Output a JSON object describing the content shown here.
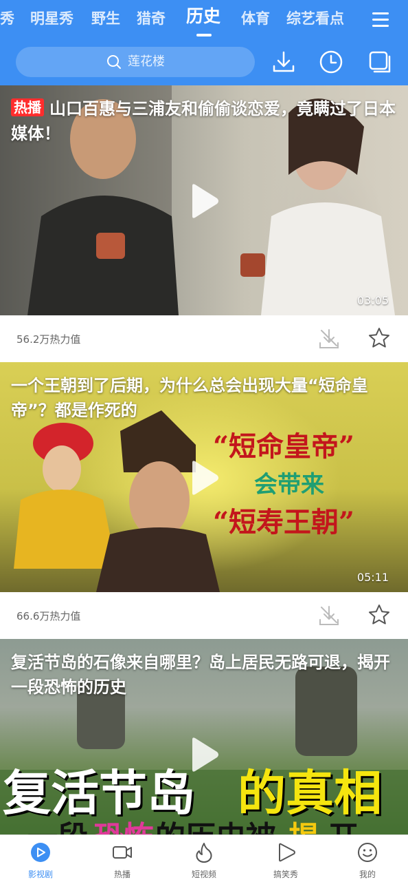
{
  "tabs": [
    "秀",
    "明星秀",
    "野生",
    "猎奇",
    "历史",
    "体育",
    "综艺看点"
  ],
  "active_tab": "历史",
  "search": {
    "placeholder": "莲花楼"
  },
  "icons": {
    "menu": "hamburger-menu-icon",
    "download": "download-icon",
    "history": "clock-icon",
    "window": "window-icon",
    "search": "search-icon",
    "play": "play-icon",
    "favorite": "star-icon"
  },
  "colors": {
    "header": "#3d8ff3",
    "hot_tag": "#ff2d2d",
    "accent": "#3d8ff3"
  },
  "videos": [
    {
      "tag": "热播",
      "title": "山口百惠与三浦友和偷偷谈恋爱，竟瞒过了日本媒体！",
      "duration": "03:05",
      "heat": "56.2万热力值",
      "thumb_text": []
    },
    {
      "tag": "",
      "title": "一个王朝到了后期，为什么总会出现大量“短命皇帝”？都是作死的",
      "duration": "05:11",
      "heat": "66.6万热力值",
      "thumb_text": [
        "“短命皇帝”",
        "会带来",
        "“短寿王朝”"
      ]
    },
    {
      "tag": "",
      "title": "复活节岛的石像来自哪里？岛上居民无路可退，揭开一段恐怖的历史",
      "duration": "",
      "heat": "",
      "thumb_text": [
        "复活节岛",
        "的真相",
        "一段",
        "恐怖",
        "的历史被",
        "揭",
        "开"
      ]
    }
  ],
  "bottom_nav": [
    {
      "label": "影视剧",
      "icon": "play-circle-icon",
      "active": true
    },
    {
      "label": "热播",
      "icon": "video-camera-icon",
      "active": false
    },
    {
      "label": "短视频",
      "icon": "flame-icon",
      "active": false
    },
    {
      "label": "搞笑秀",
      "icon": "play-bubble-icon",
      "active": false
    },
    {
      "label": "我的",
      "icon": "smiley-icon",
      "active": false
    }
  ]
}
